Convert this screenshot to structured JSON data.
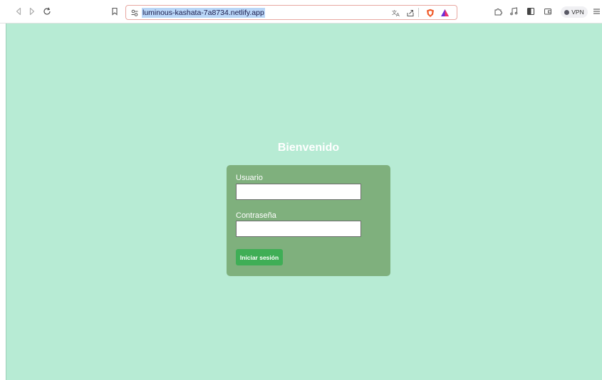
{
  "browser": {
    "url": "luminous-kashata-7a8734.netlify.app",
    "vpn_label": "VPN",
    "icons": [
      "back-icon",
      "forward-icon",
      "reload-icon",
      "bookmark-icon",
      "site-info-icon",
      "translate-icon",
      "share-icon",
      "brave-shields-icon",
      "brave-rewards-icon",
      "extensions-icon",
      "media-icon",
      "sidebar-icon",
      "wallet-icon",
      "vpn-icon",
      "menu-icon"
    ]
  },
  "page": {
    "background": "#b7ebd4",
    "title": "Bienvenido",
    "form": {
      "username_label": "Usuario",
      "username_value": "",
      "password_label": "Contraseña",
      "password_value": "",
      "submit_label": "Iniciar sesión"
    },
    "colors": {
      "card": "#7fb07d",
      "button": "#3fae56",
      "text": "#ffffff"
    }
  }
}
